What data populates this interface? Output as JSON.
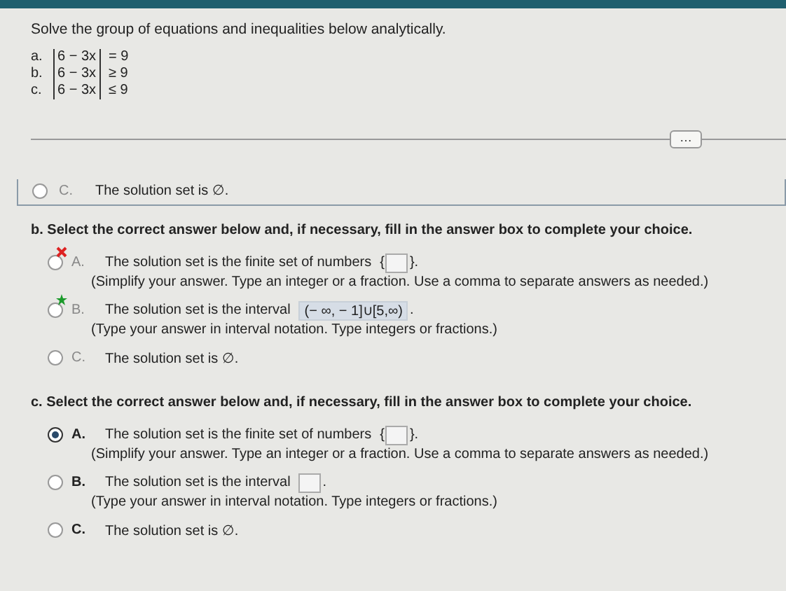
{
  "instruction": "Solve the group of equations and inequalities below analytically.",
  "problems": [
    {
      "label": "a.",
      "inner": "6 − 3x",
      "relation": "= 9"
    },
    {
      "label": "b.",
      "inner": "6 − 3x",
      "relation": "≥ 9"
    },
    {
      "label": "c.",
      "inner": "6 − 3x",
      "relation": "≤ 9"
    }
  ],
  "more_button": "…",
  "previous_option": {
    "letter": "C.",
    "text": "The solution set is ∅.",
    "selected": false
  },
  "parts": [
    {
      "prompt": "b. Select the correct answer below and, if necessary, fill in the answer box to complete your choice.",
      "graded": true,
      "options": [
        {
          "kind": "set",
          "letter": "A.",
          "text": "The solution set is the finite set of numbers",
          "open": "{",
          "close": "}.",
          "hint": "(Simplify your answer. Type an integer or a fraction. Use a comma to separate answers as needed.)",
          "selected": false,
          "incorrect": true,
          "correct": false
        },
        {
          "kind": "interval",
          "letter": "B.",
          "text": "The solution set is the interval",
          "value": "(− ∞, − 1]∪[5,∞)",
          "close": ".",
          "hint": "(Type your answer in interval notation. Type integers or fractions.)",
          "selected": false,
          "incorrect": false,
          "correct": true
        },
        {
          "kind": "empty",
          "letter": "C.",
          "text": "The solution set is ∅.",
          "selected": false,
          "incorrect": false,
          "correct": false
        }
      ]
    },
    {
      "prompt": "c. Select the correct answer below and, if necessary, fill in the answer box to complete your choice.",
      "graded": false,
      "options": [
        {
          "kind": "set",
          "letter": "A.",
          "text": "The solution set is the finite set of numbers",
          "open": "{",
          "close": "}.",
          "hint": "(Simplify your answer. Type an integer or a fraction. Use a comma to separate answers as needed.)",
          "selected": true
        },
        {
          "kind": "interval",
          "letter": "B.",
          "text": "The solution set is the interval",
          "close": ".",
          "hint": "(Type your answer in interval notation. Type integers or fractions.)",
          "selected": false
        },
        {
          "kind": "empty",
          "letter": "C.",
          "text": "The solution set is ∅.",
          "selected": false
        }
      ]
    }
  ]
}
